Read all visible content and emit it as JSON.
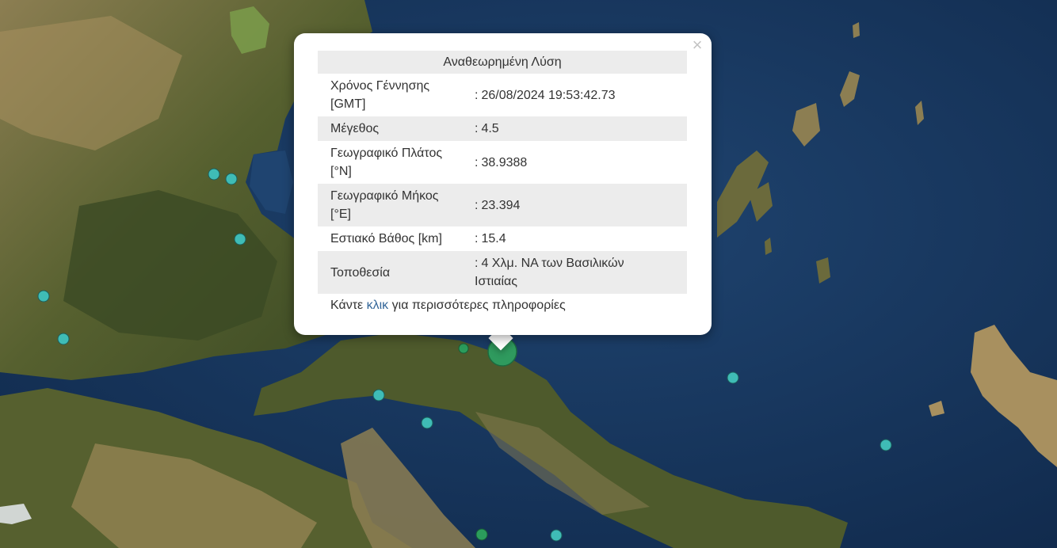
{
  "map": {
    "colors": {
      "sea_deep": "#10294b",
      "sea_shallow": "#1f4470",
      "land_dark": "#3b4a24",
      "land_mid": "#56602f",
      "land_light": "#8c7e52",
      "land_dry": "#a8905f",
      "marker_recent": "#3fbcb6",
      "marker_event": "#2b9c5c",
      "marker_focus": "#2f9a5e"
    },
    "markers": [
      {
        "id": "quake-1",
        "icon": "quake-marker"
      },
      {
        "id": "quake-2",
        "icon": "quake-marker"
      },
      {
        "id": "quake-3",
        "icon": "quake-marker"
      },
      {
        "id": "quake-4",
        "icon": "quake-marker"
      },
      {
        "id": "quake-5",
        "icon": "quake-marker"
      },
      {
        "id": "quake-6",
        "icon": "quake-marker"
      },
      {
        "id": "quake-7",
        "icon": "quake-marker"
      },
      {
        "id": "quake-8",
        "icon": "quake-marker"
      },
      {
        "id": "quake-9",
        "icon": "quake-marker"
      },
      {
        "id": "quake-10",
        "icon": "quake-marker"
      },
      {
        "id": "quake-11",
        "icon": "quake-marker"
      },
      {
        "id": "quake-12",
        "icon": "quake-marker"
      },
      {
        "id": "quake-selected",
        "icon": "quake-marker-selected"
      }
    ]
  },
  "popup": {
    "title": "Αναθεωρημένη Λύση",
    "close_icon": "close-icon",
    "rows": [
      {
        "label_line1": "Χρόνος Γέννησης",
        "label_line2": "[GMT]",
        "value": "26/08/2024 19:53:42.73"
      },
      {
        "label_line1": "Μέγεθος",
        "label_line2": "",
        "value": "4.5"
      },
      {
        "label_line1": "Γεωγραφικό Πλάτος",
        "label_line2": "[°N]",
        "value": "38.9388"
      },
      {
        "label_line1": "Γεωγραφικό Μήκος",
        "label_line2": "[°E]",
        "value": "23.394"
      },
      {
        "label_line1": "Εστιακό Βάθος [km]",
        "label_line2": "",
        "value": "15.4"
      },
      {
        "label_line1": "Τοποθεσία",
        "label_line2": "",
        "value_line1": "4 Χλμ. ΝΑ των Βασιλικών",
        "value_line2": "Ιστιαίας"
      }
    ],
    "colon": ":",
    "more_prefix": "Κάντε ",
    "more_link": "κλικ",
    "more_suffix": " για περισσότερες πληροφορίες"
  }
}
